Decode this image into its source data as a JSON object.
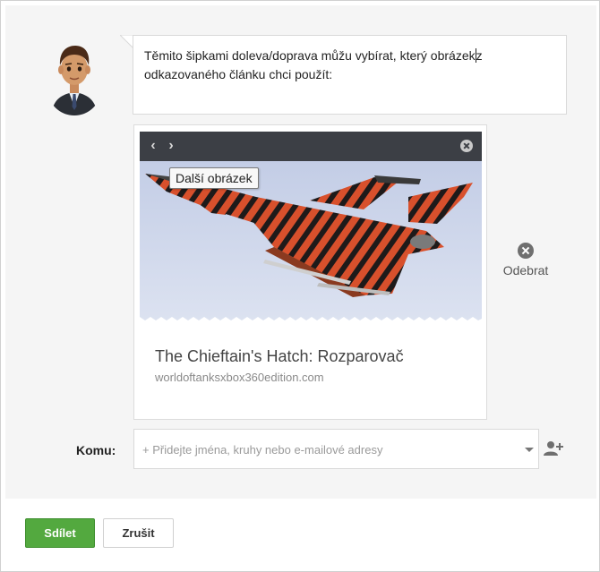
{
  "post": {
    "text_line1": "Těmito šipkami doleva/doprava můžu vybírat, který obrázek",
    "text_line1_after_caret": "z",
    "text_line2": "odkazovaného článku chci použít:"
  },
  "link_card": {
    "prev_icon": "chevron-left-icon",
    "next_icon": "chevron-right-icon",
    "close_icon": "close-icon",
    "tooltip": "Další obrázek",
    "title": "The Chieftain's Hatch: Rozparovač",
    "domain": "worldoftanksxbox360edition.com",
    "image": "eurofighter-tiger-jet-photo"
  },
  "remove": {
    "icon": "remove-icon",
    "label": "Odebrat"
  },
  "recipients": {
    "label": "Komu:",
    "placeholder": "+ Přidejte jména, kruhy nebo e-mailové adresy",
    "add_icon": "add-person-icon"
  },
  "actions": {
    "share_label": "Sdílet",
    "cancel_label": "Zrušit"
  },
  "colors": {
    "share_button": "#53a93f",
    "toolbar": "#3c3f45",
    "background": "#f5f5f5"
  }
}
